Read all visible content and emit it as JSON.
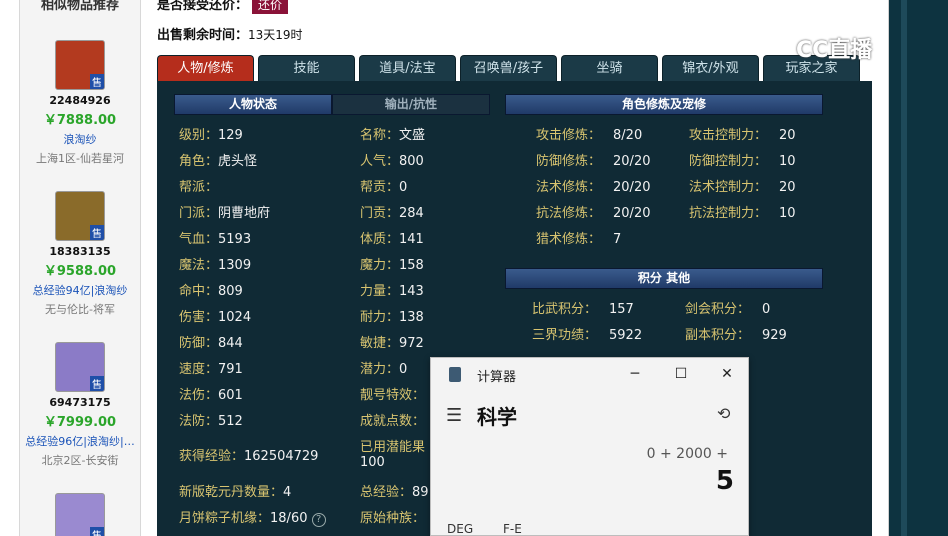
{
  "sidebar": {
    "title": "相似物品推荐",
    "items": [
      {
        "id": "22484926",
        "price": "￥7888.00",
        "tag": "浪淘纱",
        "server": "上海1区-仙若星河",
        "sell": "售",
        "avatar_color": "#b33a1f"
      },
      {
        "id": "18383135",
        "price": "￥9588.00",
        "tag": "总经验94亿|浪淘纱",
        "server": "无与伦比-将军",
        "sell": "售",
        "avatar_color": "#8a6b2a"
      },
      {
        "id": "69473175",
        "price": "￥7999.00",
        "tag": "总经验96亿|浪淘纱|…",
        "server": "北京2区-长安街",
        "sell": "售",
        "avatar_color": "#8b7bc7"
      },
      {
        "sell": "售",
        "avatar_color": "#9a8ad0"
      }
    ]
  },
  "header": {
    "accept_counter_label": "是否接受还价：",
    "counter_button": "还价",
    "remaining_label": "出售剩余时间：",
    "remaining_value": "13天19时"
  },
  "tabs": [
    "人物/修炼",
    "技能",
    "道具/法宝",
    "召唤兽/孩子",
    "坐骑",
    "锦衣/外观",
    "玩家之家"
  ],
  "panel": {
    "status_header": "人物状态",
    "output_header": "输出/抗性",
    "cultivation_header": "角色修炼及宠修",
    "score_header": "积分 其他",
    "left_stats": [
      {
        "label": "级别：",
        "value": "129"
      },
      {
        "label": "角色：",
        "value": "虎头怪"
      },
      {
        "label": "帮派：",
        "value": ""
      },
      {
        "label": "门派：",
        "value": "阴曹地府"
      },
      {
        "label": "气血：",
        "value": "5193"
      },
      {
        "label": "魔法：",
        "value": "1309"
      },
      {
        "label": "命中：",
        "value": "809"
      },
      {
        "label": "伤害：",
        "value": "1024"
      },
      {
        "label": "防御：",
        "value": "844"
      },
      {
        "label": "速度：",
        "value": "791"
      },
      {
        "label": "法伤：",
        "value": "601"
      },
      {
        "label": "法防：",
        "value": "512"
      }
    ],
    "mid_stats": [
      {
        "label": "名称：",
        "value": "文盛"
      },
      {
        "label": "人气：",
        "value": "800"
      },
      {
        "label": "帮贡：",
        "value": "0"
      },
      {
        "label": "门贡：",
        "value": "284"
      },
      {
        "label": "体质：",
        "value": "141"
      },
      {
        "label": "魔力：",
        "value": "158"
      },
      {
        "label": "力量：",
        "value": "143"
      },
      {
        "label": "耐力：",
        "value": "138"
      },
      {
        "label": "敏捷：",
        "value": "972"
      },
      {
        "label": "潜力：",
        "value": "0"
      },
      {
        "label": "靓号特效：",
        "value": ""
      },
      {
        "label": "成就点数：",
        "value": ""
      }
    ],
    "exp_label": "获得经验：",
    "exp_value": "162504729",
    "used_potential_label": "已用潜能果",
    "used_potential_value": "100",
    "qianyuan_label": "新版乾元丹数量：",
    "qianyuan_value": "4",
    "total_exp_label": "总经验：",
    "total_exp_value": "89",
    "mooncake_label": "月饼粽子机缘：",
    "mooncake_value": "18/60",
    "origin_label": "原始种族：",
    "cultivation": [
      {
        "label": "攻击修炼：",
        "value": "8/20",
        "label2": "攻击控制力：",
        "value2": "20"
      },
      {
        "label": "防御修炼：",
        "value": "20/20",
        "label2": "防御控制力：",
        "value2": "10"
      },
      {
        "label": "法术修炼：",
        "value": "20/20",
        "label2": "法术控制力：",
        "value2": "20"
      },
      {
        "label": "抗法修炼：",
        "value": "20/20",
        "label2": "抗法控制力：",
        "value2": "10"
      },
      {
        "label": "猎术修炼：",
        "value": "7",
        "label2": "",
        "value2": ""
      }
    ],
    "scores": [
      {
        "label": "比武积分：",
        "value": "157",
        "label2": "剑会积分：",
        "value2": "0"
      },
      {
        "label": "三界功绩：",
        "value": "5922",
        "label2": "副本积分：",
        "value2": "929"
      }
    ]
  },
  "watermark": "CC直播",
  "calculator": {
    "title": "计算器",
    "mode": "科学",
    "expression": "0 + 2000 +",
    "result": "5",
    "deg": "DEG",
    "fe": "F-E"
  }
}
